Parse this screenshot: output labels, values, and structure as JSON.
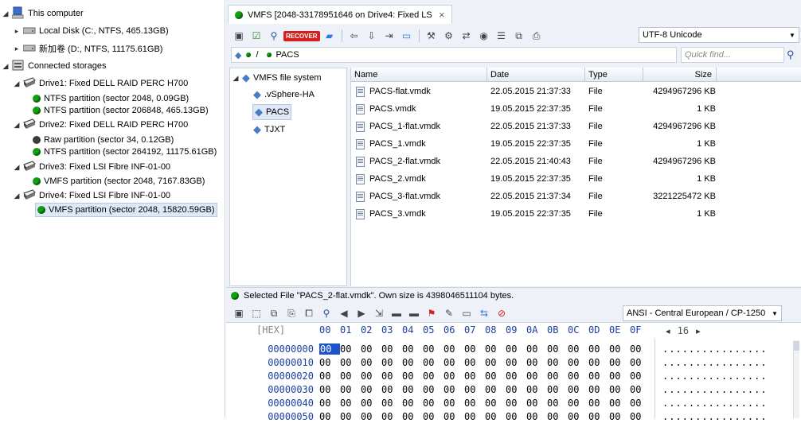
{
  "left_tree": {
    "this_computer": "This computer",
    "local_disk": "Local Disk (C:, NTFS, 465.13GB)",
    "new_volume": "新加卷 (D:, NTFS, 11175.61GB)",
    "connected_storages": "Connected storages",
    "drive1": "Drive1: Fixed DELL RAID PERC H700",
    "drive1_p1": "NTFS partition (sector 2048, 0.09GB)",
    "drive1_p2": "NTFS partition (sector 206848, 465.13GB)",
    "drive2": "Drive2: Fixed DELL RAID PERC H700",
    "drive2_p1": "Raw partition (sector 34, 0.12GB)",
    "drive2_p2": "NTFS partition (sector 264192, 11175.61GB)",
    "drive3": "Drive3: Fixed LSI Fibre INF-01-00",
    "drive3_p1": "VMFS partition (sector 2048, 7167.83GB)",
    "drive4": "Drive4: Fixed LSI Fibre INF-01-00",
    "drive4_p1": "VMFS partition (sector 2048, 15820.59GB)"
  },
  "tab": {
    "title": "VMFS [2048-33178951646 on Drive4: Fixed LSI F...",
    "close": "×"
  },
  "toolbar": {
    "recover_label": "RECOVER",
    "encoding": "UTF-8 Unicode"
  },
  "pathbar": {
    "root": "/",
    "current": "PACS"
  },
  "search": {
    "placeholder": "Quick find..."
  },
  "fs_tree": {
    "root": "VMFS file system",
    "items": [
      ".vSphere-HA",
      "PACS",
      "TJXT"
    ]
  },
  "file_list": {
    "columns": [
      "Name",
      "Date",
      "Type",
      "Size"
    ],
    "rows": [
      {
        "name": "PACS-flat.vmdk",
        "date": "22.05.2015 21:37:33",
        "type": "File",
        "size": "4294967296 KB"
      },
      {
        "name": "PACS.vmdk",
        "date": "19.05.2015 22:37:35",
        "type": "File",
        "size": "1 KB"
      },
      {
        "name": "PACS_1-flat.vmdk",
        "date": "22.05.2015 21:37:33",
        "type": "File",
        "size": "4294967296 KB"
      },
      {
        "name": "PACS_1.vmdk",
        "date": "19.05.2015 22:37:35",
        "type": "File",
        "size": "1 KB"
      },
      {
        "name": "PACS_2-flat.vmdk",
        "date": "22.05.2015 21:40:43",
        "type": "File",
        "size": "4294967296 KB"
      },
      {
        "name": "PACS_2.vmdk",
        "date": "19.05.2015 22:37:35",
        "type": "File",
        "size": "1 KB"
      },
      {
        "name": "PACS_3-flat.vmdk",
        "date": "22.05.2015 21:37:34",
        "type": "File",
        "size": "3221225472 KB"
      },
      {
        "name": "PACS_3.vmdk",
        "date": "19.05.2015 22:37:35",
        "type": "File",
        "size": "1 KB"
      }
    ]
  },
  "status": {
    "text": "Selected File \"PACS_2-flat.vmdk\". Own size is 4398046511104 bytes."
  },
  "hex": {
    "encoding": "ANSI - Central European / CP-1250",
    "mode": "[HEX]",
    "columns": [
      "00",
      "01",
      "02",
      "03",
      "04",
      "05",
      "06",
      "07",
      "08",
      "09",
      "0A",
      "0B",
      "0C",
      "0D",
      "0E",
      "0F"
    ],
    "width": "16",
    "offsets": [
      "00000000",
      "00000010",
      "00000020",
      "00000030",
      "00000040",
      "00000050"
    ],
    "byte": "00",
    "ascii_line": "................"
  },
  "colors": {
    "accent": "#1f54c8",
    "status_green": "#10a010",
    "offset_blue": "#1a3fa0"
  }
}
